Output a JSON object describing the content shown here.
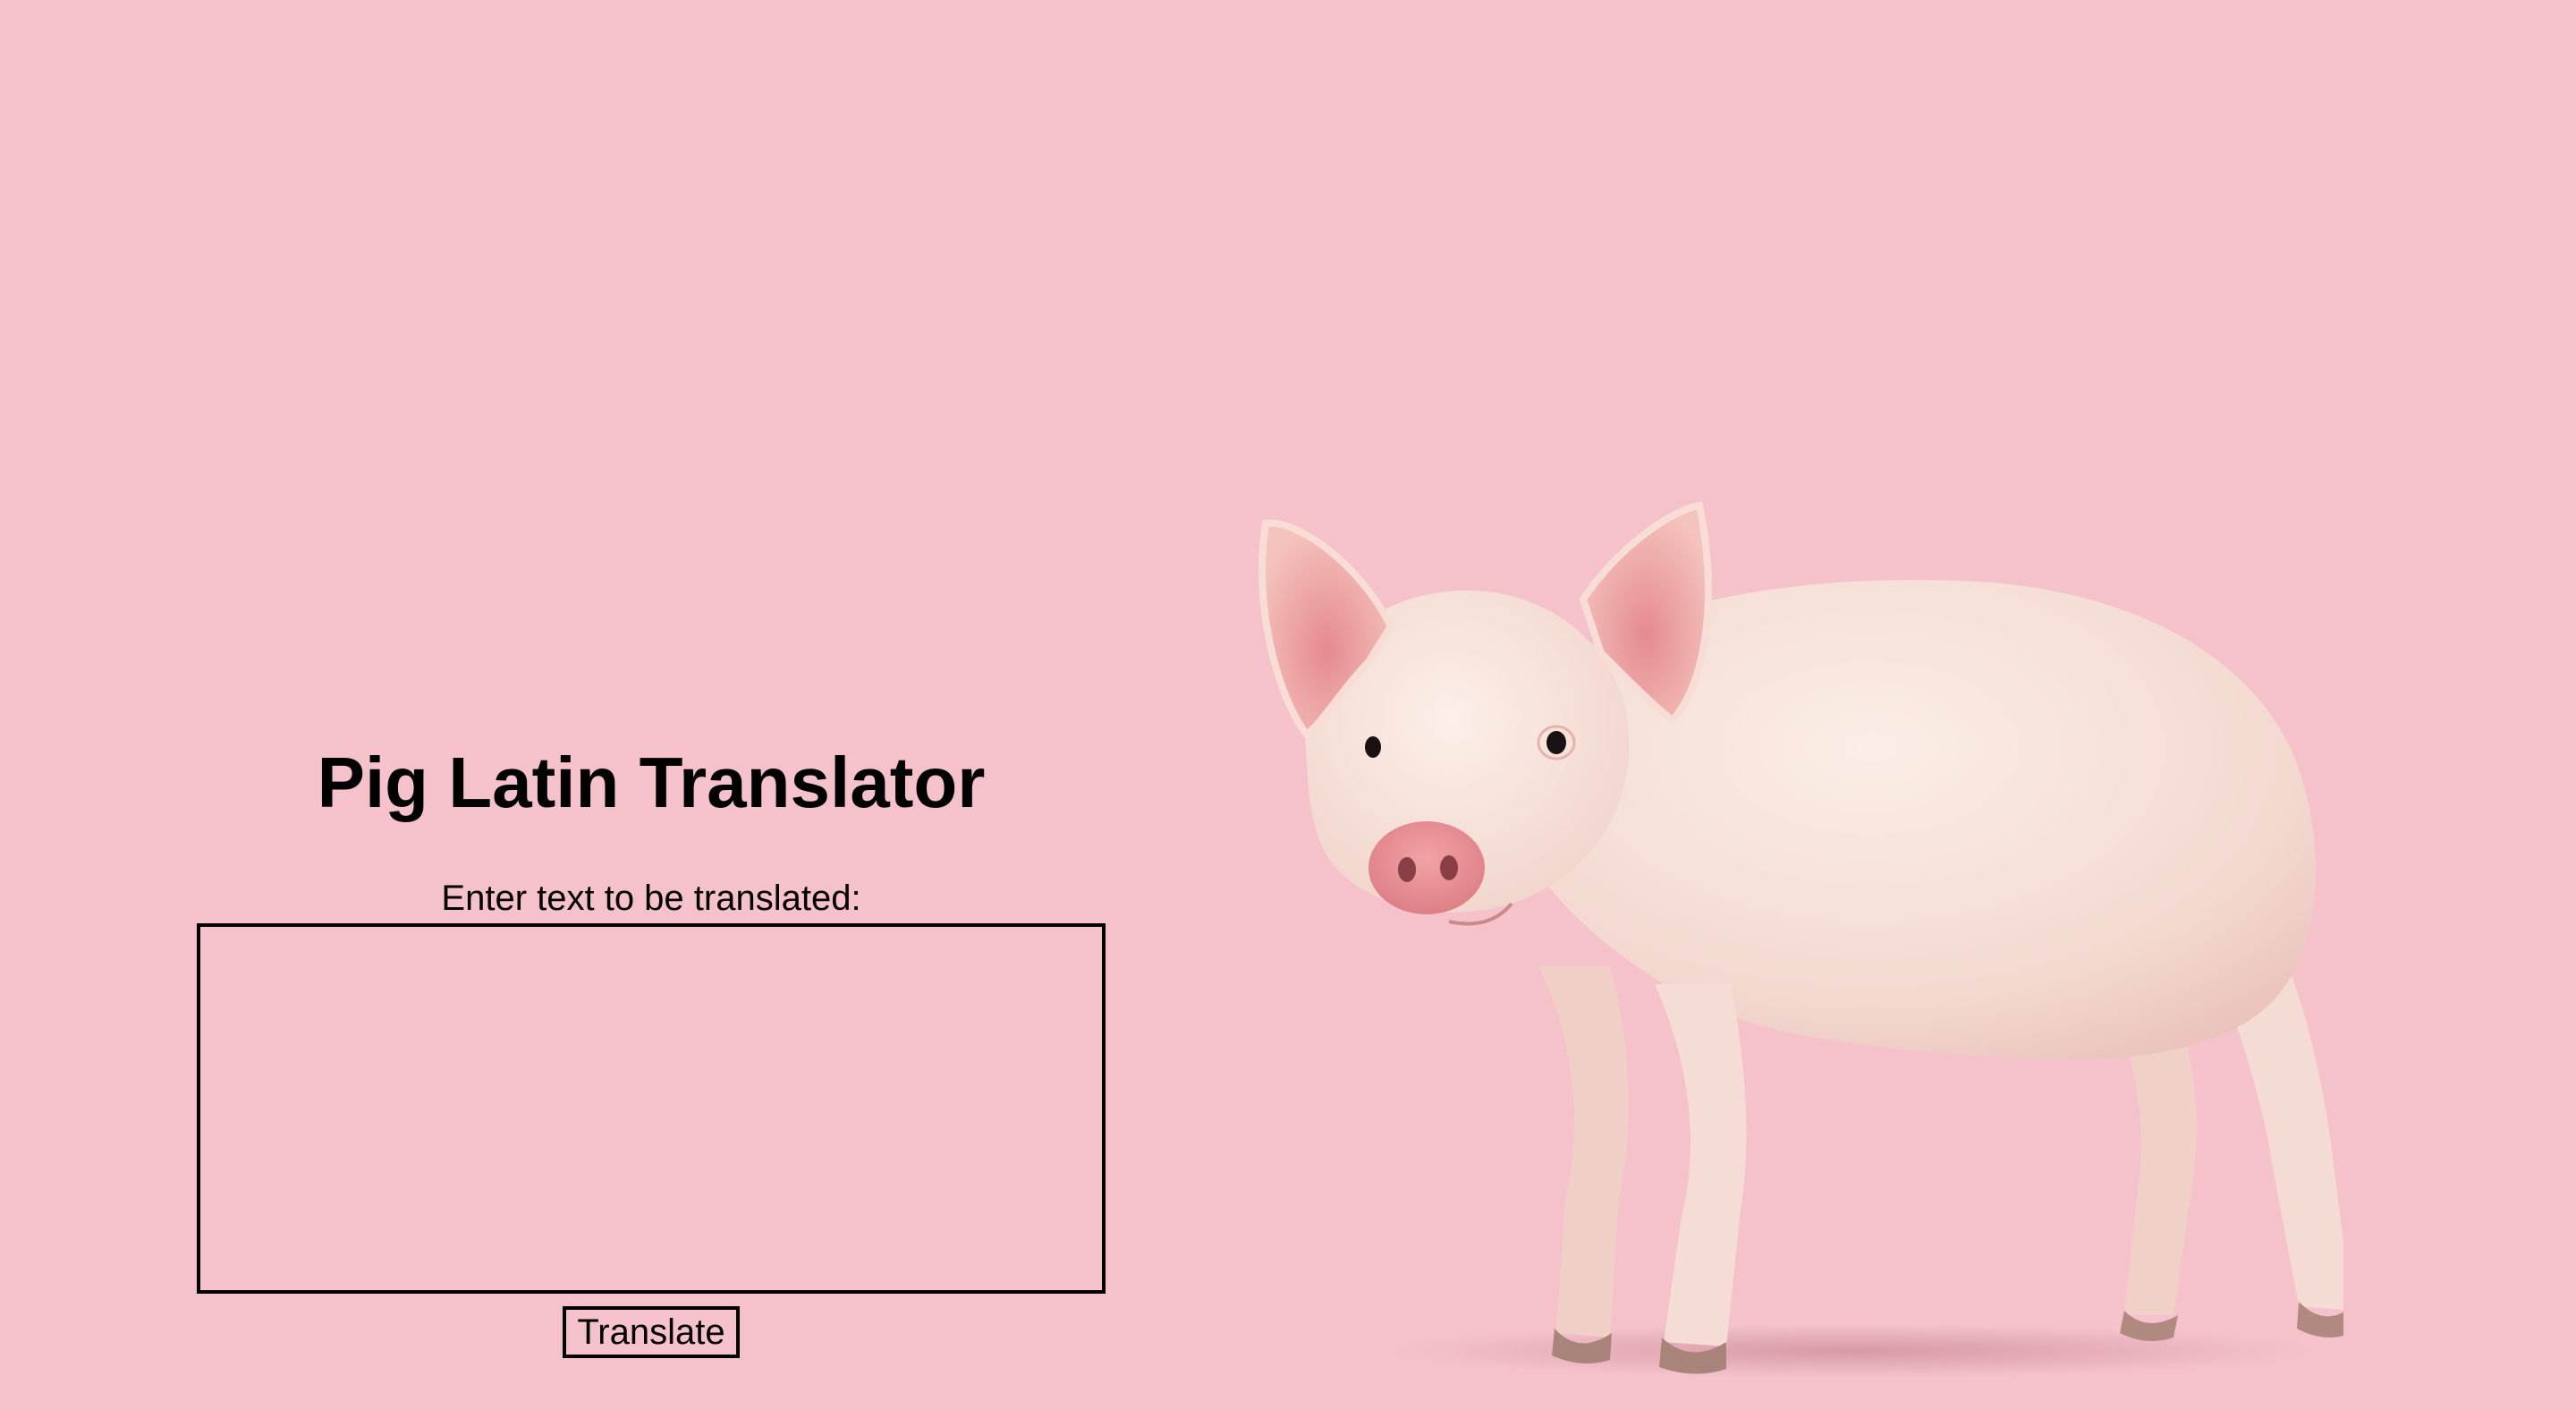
{
  "header": {
    "title": "Pig Latin Translator"
  },
  "form": {
    "prompt_label": "Enter text to be translated:",
    "input_value": "",
    "input_placeholder": "",
    "submit_label": "Translate"
  },
  "theme": {
    "background": "#f5c2cc",
    "text": "#000000"
  },
  "illustration": {
    "icon": "pig-icon"
  }
}
